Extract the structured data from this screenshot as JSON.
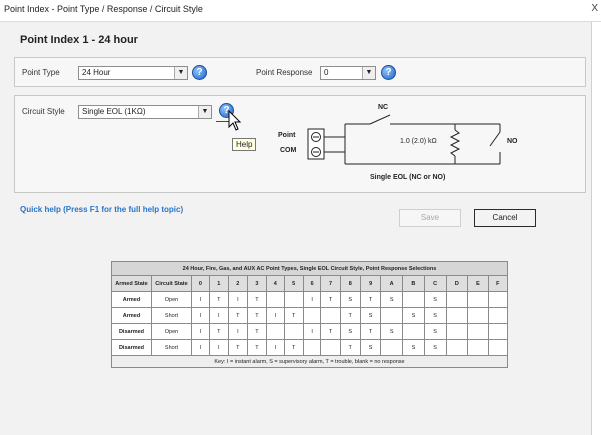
{
  "window": {
    "title": "Point Index - Point Type / Response / Circuit Style",
    "close_glyph": "X"
  },
  "heading": "Point Index 1 - 24 hour",
  "point_type": {
    "label": "Point Type",
    "value": "24 Hour"
  },
  "point_response": {
    "label": "Point Response",
    "value": "0"
  },
  "circuit_style": {
    "label": "Circuit Style",
    "value": "Single EOL (1KΩ)"
  },
  "help_glyph": "?",
  "tooltip": "Help",
  "diagram": {
    "nc": "NC",
    "no": "NO",
    "point": "Point",
    "com": "COM",
    "resistor": "1.0 (2.0) kΩ",
    "caption": "Single EOL (NC or NO)"
  },
  "quick_help": "Quick help (Press F1 for the full help topic)",
  "buttons": {
    "save": "Save",
    "cancel": "Cancel"
  },
  "table": {
    "title": "24 Hour, Fire, Gas, and AUX AC Point Types, Single EOL Circuit Style, Point Response Selections",
    "headers": [
      "Armed State",
      "Circuit State",
      "0",
      "1",
      "2",
      "3",
      "4",
      "5",
      "6",
      "7",
      "8",
      "9",
      "A",
      "B",
      "C",
      "D",
      "E",
      "F"
    ],
    "rows": [
      [
        "Armed",
        "Open",
        "I",
        "T",
        "I",
        "T",
        "",
        "",
        "I",
        "T",
        "S",
        "T",
        "S",
        "",
        "S",
        "",
        "",
        ""
      ],
      [
        "Armed",
        "Short",
        "I",
        "I",
        "T",
        "T",
        "I",
        "T",
        "",
        "",
        "T",
        "S",
        "",
        "S",
        "S",
        "",
        "",
        ""
      ],
      [
        "Disarmed",
        "Open",
        "I",
        "T",
        "I",
        "T",
        "",
        "",
        "I",
        "T",
        "S",
        "T",
        "S",
        "",
        "S",
        "",
        "",
        ""
      ],
      [
        "Disarmed",
        "Short",
        "I",
        "I",
        "T",
        "T",
        "I",
        "T",
        "",
        "",
        "T",
        "S",
        "",
        "S",
        "S",
        "",
        "",
        ""
      ]
    ],
    "key": "Key: I = instant alarm, S = supervisory alarm, T = trouble, blank = no response"
  },
  "colors": {
    "accent": "#2a75c8",
    "help_icon": "#1b64c8"
  }
}
